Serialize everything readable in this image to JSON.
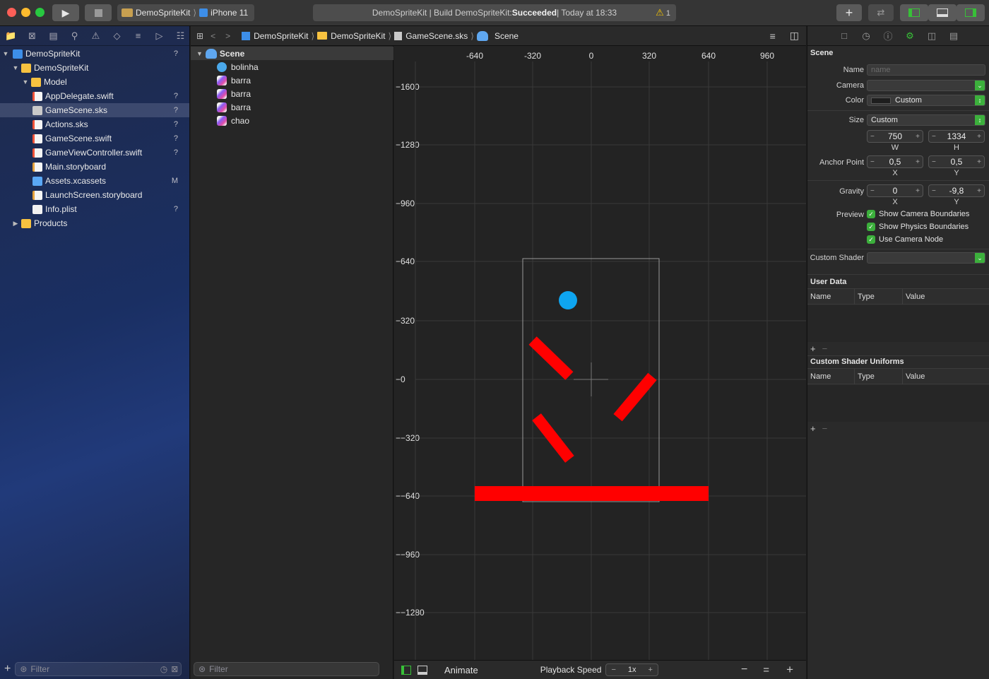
{
  "toolbar": {
    "scheme_name": "DemoSpriteKit",
    "destination": "iPhone 11",
    "status_prefix": "DemoSpriteKit | Build DemoSpriteKit: ",
    "status_result": "Succeeded",
    "status_time": " | Today at 18:33",
    "warning_count": "1"
  },
  "navigator": {
    "items": [
      {
        "label": "DemoSpriteKit",
        "badge": "?"
      },
      {
        "label": "DemoSpriteKit",
        "badge": ""
      },
      {
        "label": "Model",
        "badge": ""
      },
      {
        "label": "AppDelegate.swift",
        "badge": "?"
      },
      {
        "label": "GameScene.sks",
        "badge": "?"
      },
      {
        "label": "Actions.sks",
        "badge": "?"
      },
      {
        "label": "GameScene.swift",
        "badge": "?"
      },
      {
        "label": "GameViewController.swift",
        "badge": "?"
      },
      {
        "label": "Main.storyboard",
        "badge": ""
      },
      {
        "label": "Assets.xcassets",
        "badge": "M"
      },
      {
        "label": "LaunchScreen.storyboard",
        "badge": ""
      },
      {
        "label": "Info.plist",
        "badge": "?"
      },
      {
        "label": "Products",
        "badge": ""
      }
    ],
    "filter_placeholder": "Filter"
  },
  "jumpbar": {
    "crumbs": [
      "DemoSpriteKit",
      "DemoSpriteKit",
      "GameScene.sks",
      "Scene"
    ]
  },
  "outline": {
    "root": "Scene",
    "nodes": [
      "bolinha",
      "barra",
      "barra",
      "barra",
      "chao"
    ],
    "filter_placeholder": "Filter"
  },
  "canvas": {
    "x_ticks": [
      "-640",
      "-320",
      "0",
      "320",
      "640",
      "960"
    ],
    "y_ticks": [
      "−1600",
      "−1280",
      "−960",
      "−640",
      "−320",
      "−0",
      "−−320",
      "−−640",
      "−−960",
      "−−1280"
    ],
    "colors": {
      "bar": "#ff0000",
      "ball": "#0ea5f0",
      "grid": "#3a3a3a",
      "frame": "#9a9a9a"
    }
  },
  "canvas_bottom": {
    "animate_label": "Animate",
    "playback_label": "Playback Speed",
    "speed_value": "1x"
  },
  "inspector": {
    "section_title": "Scene",
    "name_label": "Name",
    "name_placeholder": "name",
    "camera_label": "Camera",
    "color_label": "Color",
    "color_value": "Custom",
    "size_label": "Size",
    "size_value": "Custom",
    "width_value": "750",
    "height_value": "1334",
    "w_label": "W",
    "h_label": "H",
    "anchor_label": "Anchor Point",
    "anchor_x": "0,5",
    "anchor_y": "0,5",
    "x_label": "X",
    "y_label": "Y",
    "gravity_label": "Gravity",
    "gravity_x": "0",
    "gravity_y": "-9,8",
    "preview_label": "Preview",
    "checks": [
      "Show Camera Boundaries",
      "Show Physics Boundaries",
      "Use Camera Node"
    ],
    "shader_label": "Custom Shader",
    "user_data_title": "User Data",
    "uniforms_title": "Custom Shader Uniforms",
    "col_name": "Name",
    "col_type": "Type",
    "col_value": "Value"
  }
}
